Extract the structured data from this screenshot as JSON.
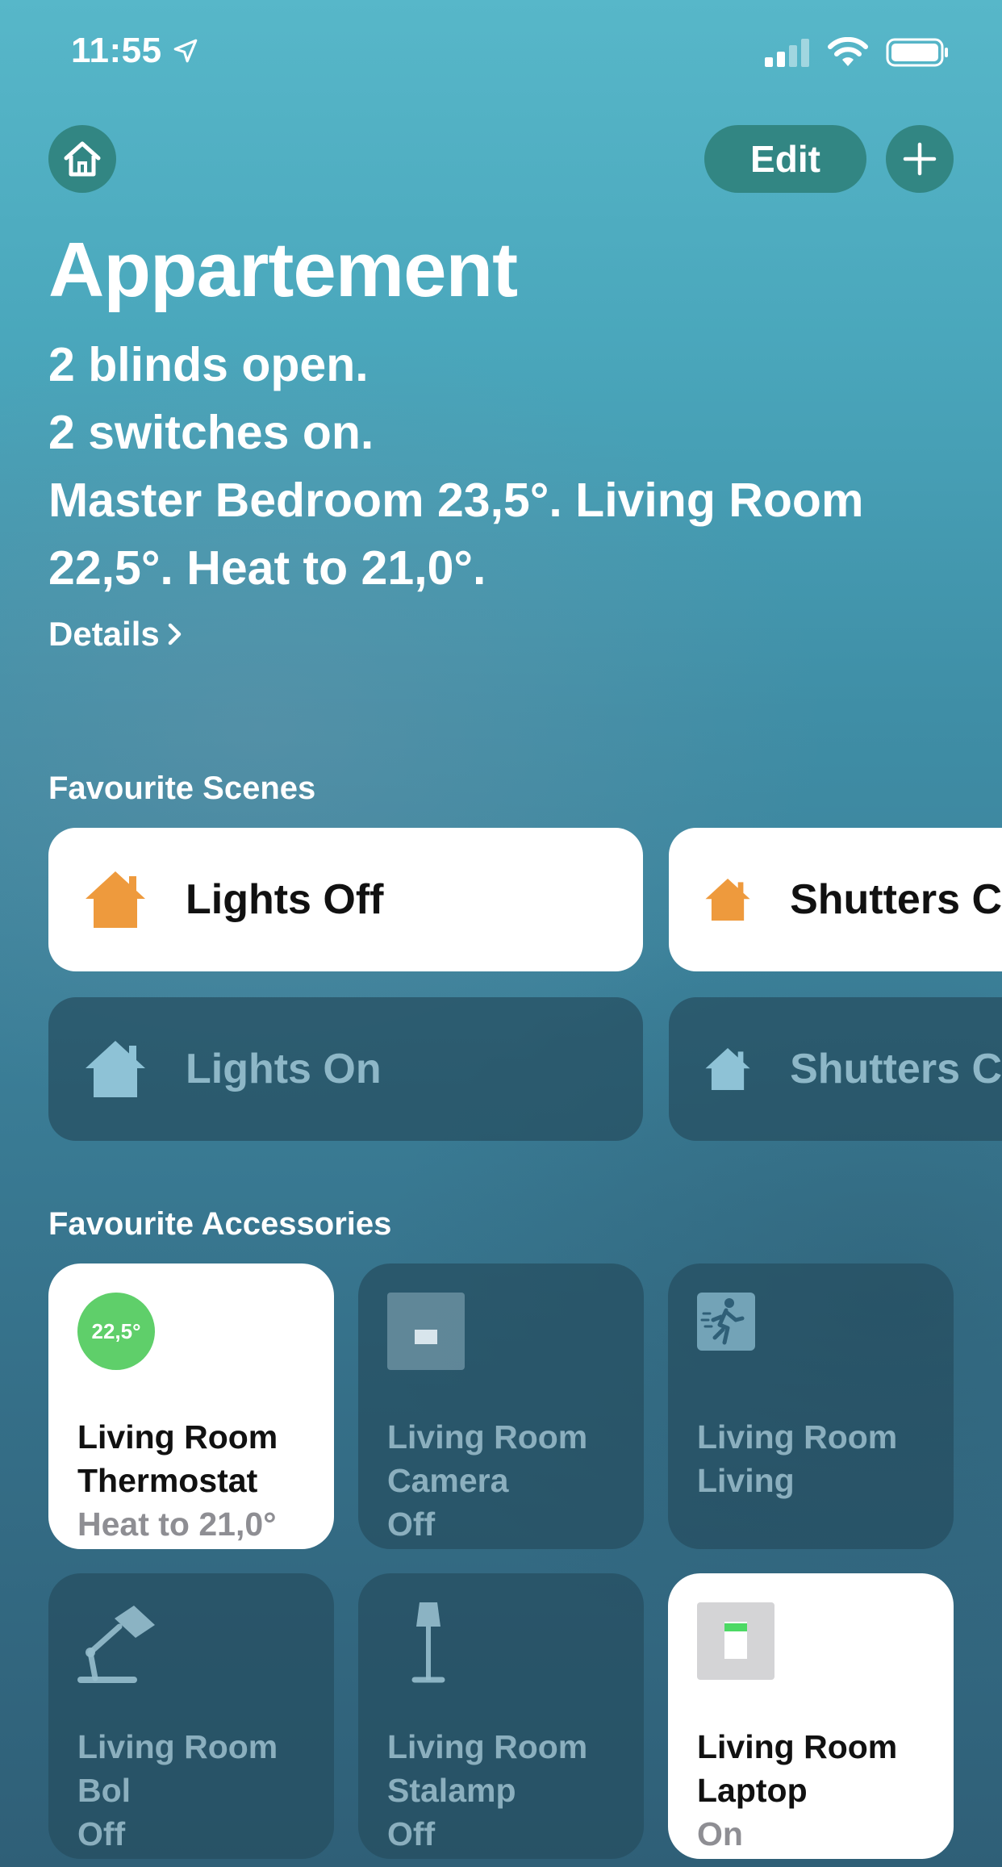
{
  "status_bar": {
    "time": "11:55"
  },
  "header": {
    "edit_label": "Edit"
  },
  "home": {
    "title": "Appartement",
    "summary_lines": [
      "2 blinds open.",
      "2 switches on.",
      "Master Bedroom 23,5°. Living Room 22,5°. Heat to 21,0°."
    ],
    "details_label": "Details"
  },
  "scenes": {
    "section_label": "Favourite Scenes",
    "items": [
      {
        "label": "Lights Off",
        "active": true
      },
      {
        "label": "Shutters C",
        "active": true
      },
      {
        "label": "Lights On",
        "active": false
      },
      {
        "label": "Shutters C",
        "active": false
      }
    ]
  },
  "accessories": {
    "section_label": "Favourite Accessories",
    "items": [
      {
        "name_line1": "Living Room",
        "name_line2": "Thermostat",
        "state": "Heat to 21,0°",
        "badge": "22,5°",
        "icon": "thermostat-icon",
        "active": true
      },
      {
        "name_line1": "Living Room",
        "name_line2": "Camera",
        "state": "Off",
        "icon": "switch-icon",
        "active": false
      },
      {
        "name_line1": "Living Room",
        "name_line2": "Living",
        "state": "",
        "icon": "motion-sensor-icon",
        "active": false
      },
      {
        "name_line1": "Living Room",
        "name_line2": "Bol",
        "state": "Off",
        "icon": "desk-lamp-icon",
        "active": false
      },
      {
        "name_line1": "Living Room",
        "name_line2": "Stalamp",
        "state": "Off",
        "icon": "floor-lamp-icon",
        "active": false
      },
      {
        "name_line1": "Living Room",
        "name_line2": "Laptop",
        "state": "On",
        "icon": "switch-on-icon",
        "active": true
      }
    ]
  },
  "colors": {
    "scene_icon_on": "#ee9a3d",
    "scene_icon_off": "#8ec2d6",
    "thermostat_badge": "#5fcf6a",
    "switch_indicator": "#4cd964"
  }
}
